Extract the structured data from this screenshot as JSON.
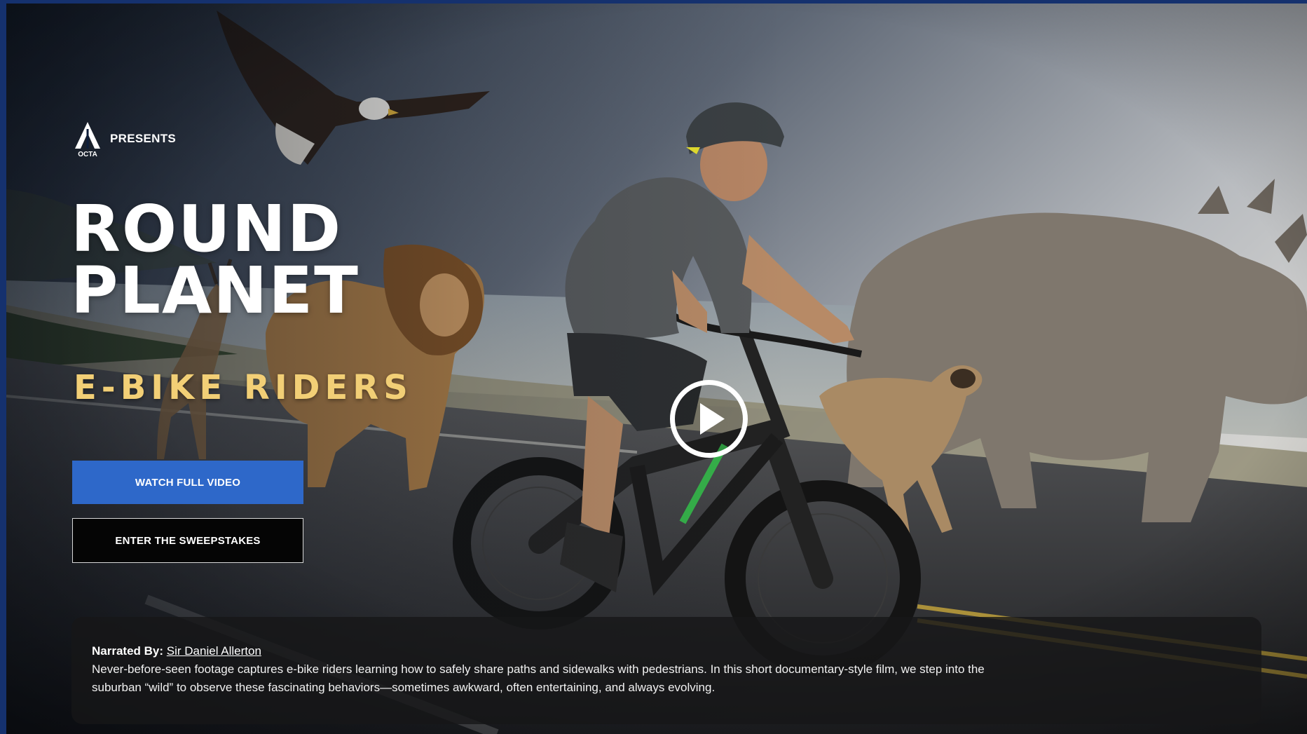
{
  "brand": {
    "logo_text": "OCTA",
    "presents_label": "PRESENTS"
  },
  "hero": {
    "title_line1": "ROUND",
    "title_line2": "PLANET",
    "subtitle": "E-BIKE RIDERS",
    "watch_button_label": "WATCH FULL VIDEO",
    "sweepstakes_button_label": "ENTER THE SWEEPSTAKES",
    "play_icon": "play-circle-icon"
  },
  "caption": {
    "narrated_label": "Narrated By:",
    "narrator_name": "Sir Daniel Allerton",
    "description": "Never-before-seen footage captures e-bike riders learning how to safely share paths and sidewalks with pedestrians. In this short documentary-style film, we step into the suburban “wild” to observe these fascinating behaviors—sometimes awkward, often entertaining, and always evolving."
  },
  "colors": {
    "frame": "#15316e",
    "accent_blue": "#2e68c9",
    "title_gold": "#f2cf76",
    "caption_bg": "#161618"
  }
}
